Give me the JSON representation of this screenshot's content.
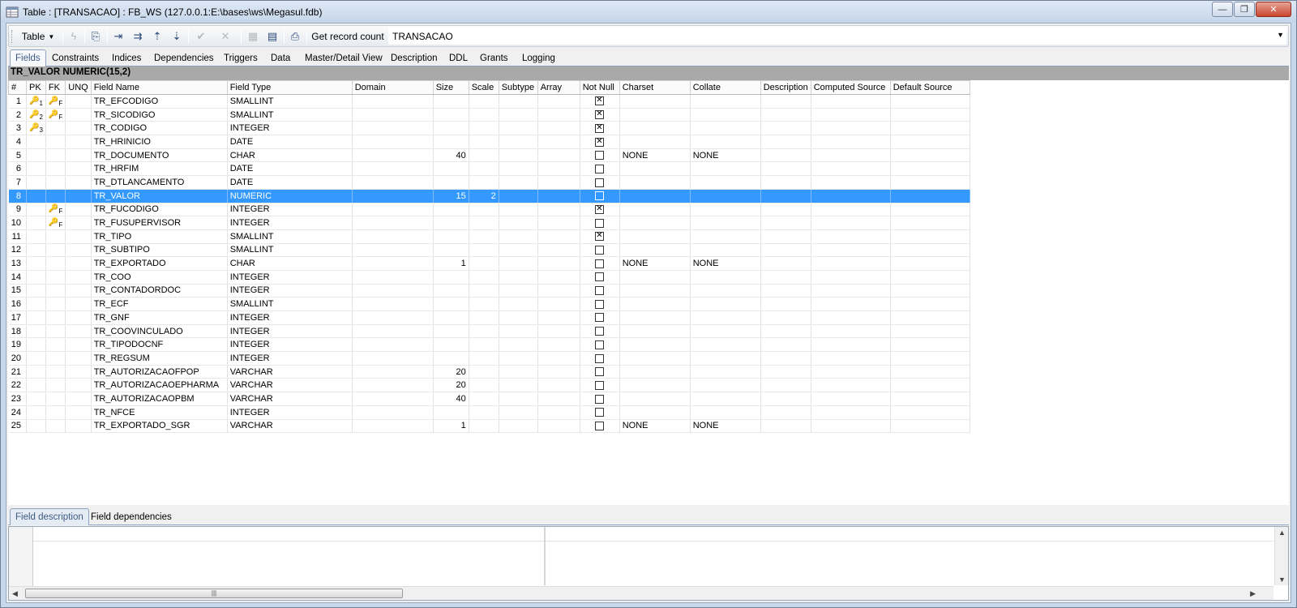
{
  "window": {
    "title": "Table : [TRANSACAO] : FB_WS (127.0.0.1:E:\\bases\\ws\\Megasul.fdb)",
    "minimize": "—",
    "maximize": "❐",
    "close": "✕"
  },
  "toolbar": {
    "table_menu": "Table",
    "get_record_count": "Get record count",
    "table_name": "TRANSACAO"
  },
  "tabs": [
    "Fields",
    "Constraints",
    "Indices",
    "Dependencies",
    "Triggers",
    "Data",
    "Master/Detail View",
    "Description",
    "DDL",
    "Grants",
    "Logging"
  ],
  "grid": {
    "current_field": "TR_VALOR NUMERIC(15,2)",
    "columns": [
      "#",
      "PK",
      "FK",
      "UNQ",
      "Field Name",
      "Field Type",
      "Domain",
      "Size",
      "Scale",
      "Subtype",
      "Array",
      "Not Null",
      "Charset",
      "Collate",
      "Description",
      "Computed Source",
      "Default Source"
    ],
    "rows": [
      {
        "n": "1",
        "pk": "1",
        "fk": "F",
        "name": "TR_EFCODIGO",
        "type": "SMALLINT",
        "size": "",
        "scale": "",
        "nn": true,
        "charset": "",
        "collate": ""
      },
      {
        "n": "2",
        "pk": "2",
        "fk": "F",
        "name": "TR_SICODIGO",
        "type": "SMALLINT",
        "size": "",
        "scale": "",
        "nn": true,
        "charset": "",
        "collate": ""
      },
      {
        "n": "3",
        "pk": "3",
        "fk": "",
        "name": "TR_CODIGO",
        "type": "INTEGER",
        "size": "",
        "scale": "",
        "nn": true,
        "charset": "",
        "collate": ""
      },
      {
        "n": "4",
        "pk": "",
        "fk": "",
        "name": "TR_HRINICIO",
        "type": "DATE",
        "size": "",
        "scale": "",
        "nn": true,
        "charset": "",
        "collate": ""
      },
      {
        "n": "5",
        "pk": "",
        "fk": "",
        "name": "TR_DOCUMENTO",
        "type": "CHAR",
        "size": "40",
        "scale": "",
        "nn": false,
        "charset": "NONE",
        "collate": "NONE"
      },
      {
        "n": "6",
        "pk": "",
        "fk": "",
        "name": "TR_HRFIM",
        "type": "DATE",
        "size": "",
        "scale": "",
        "nn": false,
        "charset": "",
        "collate": ""
      },
      {
        "n": "7",
        "pk": "",
        "fk": "",
        "name": "TR_DTLANCAMENTO",
        "type": "DATE",
        "size": "",
        "scale": "",
        "nn": false,
        "charset": "",
        "collate": ""
      },
      {
        "n": "8",
        "pk": "",
        "fk": "",
        "name": "TR_VALOR",
        "type": "NUMERIC",
        "size": "15",
        "scale": "2",
        "nn": false,
        "charset": "",
        "collate": "",
        "selected": true
      },
      {
        "n": "9",
        "pk": "",
        "fk": "F",
        "name": "TR_FUCODIGO",
        "type": "INTEGER",
        "size": "",
        "scale": "",
        "nn": true,
        "charset": "",
        "collate": ""
      },
      {
        "n": "10",
        "pk": "",
        "fk": "F",
        "name": "TR_FUSUPERVISOR",
        "type": "INTEGER",
        "size": "",
        "scale": "",
        "nn": false,
        "charset": "",
        "collate": ""
      },
      {
        "n": "11",
        "pk": "",
        "fk": "",
        "name": "TR_TIPO",
        "type": "SMALLINT",
        "size": "",
        "scale": "",
        "nn": true,
        "charset": "",
        "collate": ""
      },
      {
        "n": "12",
        "pk": "",
        "fk": "",
        "name": "TR_SUBTIPO",
        "type": "SMALLINT",
        "size": "",
        "scale": "",
        "nn": false,
        "charset": "",
        "collate": ""
      },
      {
        "n": "13",
        "pk": "",
        "fk": "",
        "name": "TR_EXPORTADO",
        "type": "CHAR",
        "size": "1",
        "scale": "",
        "nn": false,
        "charset": "NONE",
        "collate": "NONE"
      },
      {
        "n": "14",
        "pk": "",
        "fk": "",
        "name": "TR_COO",
        "type": "INTEGER",
        "size": "",
        "scale": "",
        "nn": false,
        "charset": "",
        "collate": ""
      },
      {
        "n": "15",
        "pk": "",
        "fk": "",
        "name": "TR_CONTADORDOC",
        "type": "INTEGER",
        "size": "",
        "scale": "",
        "nn": false,
        "charset": "",
        "collate": ""
      },
      {
        "n": "16",
        "pk": "",
        "fk": "",
        "name": "TR_ECF",
        "type": "SMALLINT",
        "size": "",
        "scale": "",
        "nn": false,
        "charset": "",
        "collate": ""
      },
      {
        "n": "17",
        "pk": "",
        "fk": "",
        "name": "TR_GNF",
        "type": "INTEGER",
        "size": "",
        "scale": "",
        "nn": false,
        "charset": "",
        "collate": ""
      },
      {
        "n": "18",
        "pk": "",
        "fk": "",
        "name": "TR_COOVINCULADO",
        "type": "INTEGER",
        "size": "",
        "scale": "",
        "nn": false,
        "charset": "",
        "collate": ""
      },
      {
        "n": "19",
        "pk": "",
        "fk": "",
        "name": "TR_TIPODOCNF",
        "type": "INTEGER",
        "size": "",
        "scale": "",
        "nn": false,
        "charset": "",
        "collate": ""
      },
      {
        "n": "20",
        "pk": "",
        "fk": "",
        "name": "TR_REGSUM",
        "type": "INTEGER",
        "size": "",
        "scale": "",
        "nn": false,
        "charset": "",
        "collate": ""
      },
      {
        "n": "21",
        "pk": "",
        "fk": "",
        "name": "TR_AUTORIZACAOFPOP",
        "type": "VARCHAR",
        "size": "20",
        "scale": "",
        "nn": false,
        "charset": "",
        "collate": ""
      },
      {
        "n": "22",
        "pk": "",
        "fk": "",
        "name": "TR_AUTORIZACAOEPHARMA",
        "type": "VARCHAR",
        "size": "20",
        "scale": "",
        "nn": false,
        "charset": "",
        "collate": ""
      },
      {
        "n": "23",
        "pk": "",
        "fk": "",
        "name": "TR_AUTORIZACAOPBM",
        "type": "VARCHAR",
        "size": "40",
        "scale": "",
        "nn": false,
        "charset": "",
        "collate": ""
      },
      {
        "n": "24",
        "pk": "",
        "fk": "",
        "name": "TR_NFCE",
        "type": "INTEGER",
        "size": "",
        "scale": "",
        "nn": false,
        "charset": "",
        "collate": ""
      },
      {
        "n": "25",
        "pk": "",
        "fk": "",
        "name": "TR_EXPORTADO_SGR",
        "type": "VARCHAR",
        "size": "1",
        "scale": "",
        "nn": false,
        "charset": "NONE",
        "collate": "NONE"
      }
    ]
  },
  "bottom_tabs": [
    "Field description",
    "Field dependencies"
  ],
  "colors": {
    "selection": "#3399ff",
    "header_bar": "#a9a9a9"
  }
}
